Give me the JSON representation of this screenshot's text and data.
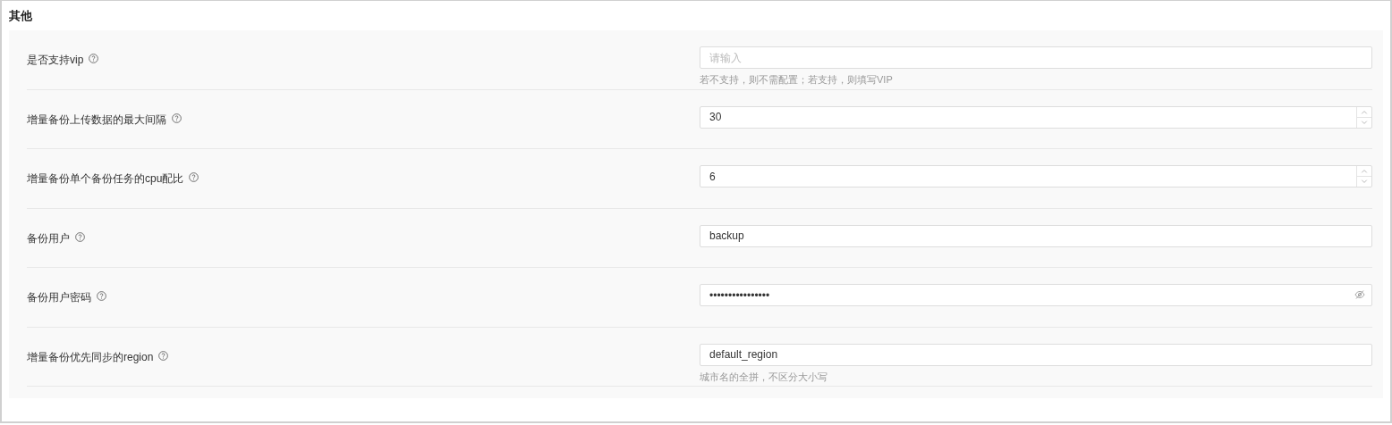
{
  "section": {
    "title": "其他"
  },
  "fields": [
    {
      "kind": "text",
      "label": "是否支持vip",
      "placeholder": "请输入",
      "help": "若不支持，则不需配置；若支持，则填写VIP"
    },
    {
      "kind": "number",
      "label": "增量备份上传数据的最大间隔",
      "value": "30"
    },
    {
      "kind": "number",
      "label": "增量备份单个备份任务的cpu配比",
      "value": "6"
    },
    {
      "kind": "text",
      "label": "备份用户",
      "value": "backup"
    },
    {
      "kind": "password",
      "label": "备份用户密码",
      "value": "••••••••••••••••"
    },
    {
      "kind": "text",
      "label": "增量备份优先同步的region",
      "value": "default_region",
      "help": "城市名的全拼，不区分大小写"
    }
  ]
}
